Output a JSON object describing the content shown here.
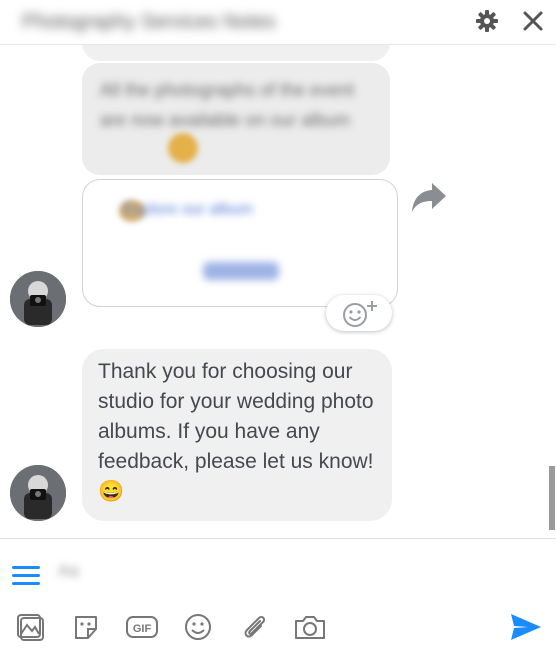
{
  "header": {
    "title": "Photography Services Notes",
    "gear_icon": "gear-icon",
    "close_icon": "close-icon"
  },
  "chat": {
    "blurred_message": "All the photographs of the event are now available on our album",
    "card": {
      "link_text": "Explore our album",
      "button_label": "Button"
    },
    "react_icon": "add-reaction-icon",
    "share_icon": "share-icon",
    "message": "Thank you for choosing our studio for your wedding photo albums. If you have any feedback, please let us know!",
    "message_emoji": "😄"
  },
  "composer": {
    "placeholder": "Aa",
    "tools": [
      "image-icon",
      "sticker-icon",
      "gif-icon",
      "emoji-icon",
      "attachment-icon",
      "camera-icon"
    ],
    "send_icon": "send-icon"
  },
  "colors": {
    "accent": "#1a8cff",
    "bubble": "#f1f0f0",
    "text": "#444950"
  }
}
